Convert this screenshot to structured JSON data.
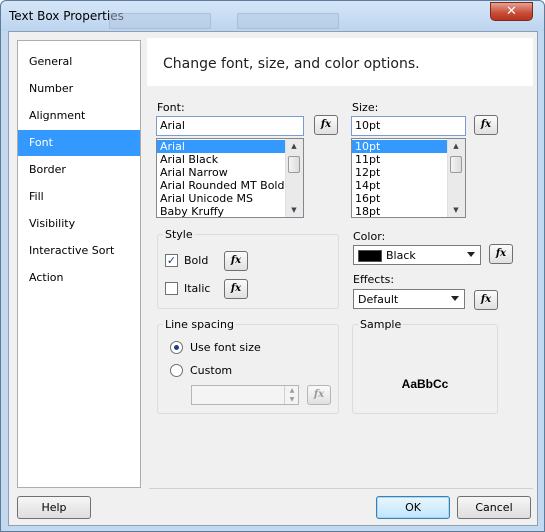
{
  "window": {
    "title": "Text Box Properties",
    "close_symbol": "✕"
  },
  "nav": {
    "items": [
      {
        "label": "General",
        "selected": false
      },
      {
        "label": "Number",
        "selected": false
      },
      {
        "label": "Alignment",
        "selected": false
      },
      {
        "label": "Font",
        "selected": true
      },
      {
        "label": "Border",
        "selected": false
      },
      {
        "label": "Fill",
        "selected": false
      },
      {
        "label": "Visibility",
        "selected": false
      },
      {
        "label": "Interactive Sort",
        "selected": false
      },
      {
        "label": "Action",
        "selected": false
      }
    ]
  },
  "panel": {
    "heading": "Change font, size, and color options.",
    "font": {
      "label": "Font:",
      "value": "Arial",
      "list": [
        "Arial",
        "Arial Black",
        "Arial Narrow",
        "Arial Rounded MT Bold",
        "Arial Unicode MS",
        "Baby Kruffy"
      ],
      "selected": "Arial"
    },
    "size": {
      "label": "Size:",
      "value": "10pt",
      "list": [
        "10pt",
        "11pt",
        "12pt",
        "14pt",
        "16pt",
        "18pt"
      ],
      "selected": "10pt"
    },
    "fx_label": "fx",
    "style": {
      "title": "Style",
      "bold": {
        "label": "Bold",
        "checked": true
      },
      "italic": {
        "label": "Italic",
        "checked": false
      }
    },
    "color": {
      "label": "Color:",
      "value": "Black",
      "swatch": "#000000"
    },
    "effects": {
      "label": "Effects:",
      "value": "Default"
    },
    "line_spacing": {
      "title": "Line spacing",
      "use_font_size": "Use font size",
      "custom": "Custom",
      "custom_value": ""
    },
    "sample": {
      "title": "Sample",
      "text": "AaBbCc"
    }
  },
  "buttons": {
    "help": "Help",
    "ok": "OK",
    "cancel": "Cancel"
  },
  "colors": {
    "selection": "#3399ff",
    "dialog_bg": "#f0f0f0",
    "frame": "#c2d9f0"
  }
}
